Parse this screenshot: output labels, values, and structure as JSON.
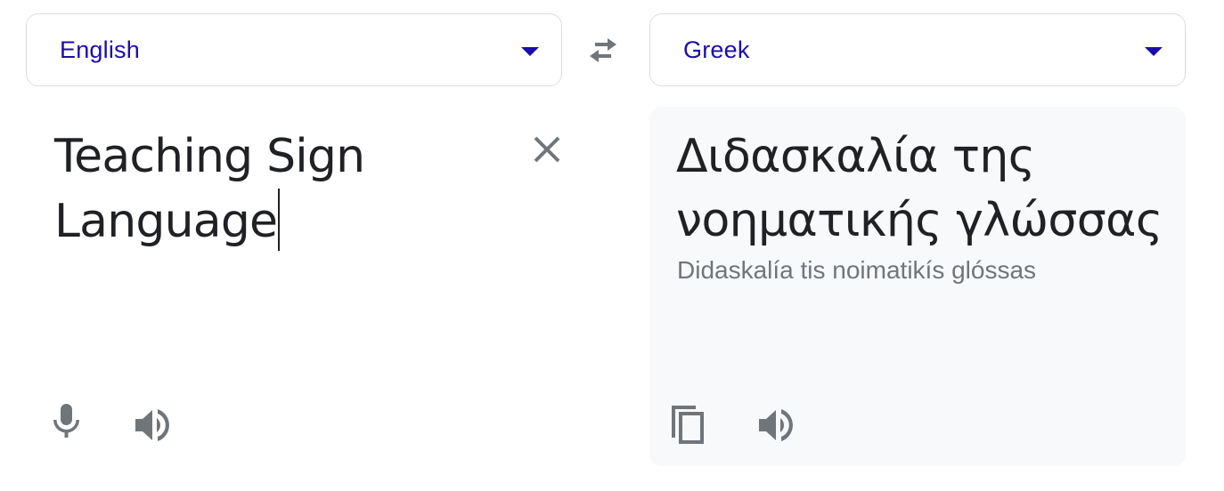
{
  "source_language": {
    "label": "English"
  },
  "target_language": {
    "label": "Greek"
  },
  "source": {
    "line1": "Teaching Sign",
    "line2": "Language"
  },
  "target": {
    "line1": "Διδασκαλία της",
    "line2": "νοηματικής γλώσσας",
    "transliteration": "Didaskalía tis noimatikís glóssas"
  },
  "icons": {
    "swap": "swap-horiz-icon",
    "clear": "close-icon",
    "mic": "microphone-icon",
    "listen": "speaker-icon",
    "copy": "copy-icon"
  },
  "colors": {
    "language_link": "#1a0dab",
    "icon_gray": "#70757a",
    "text": "#202124",
    "target_bg": "#f8f9fa"
  }
}
